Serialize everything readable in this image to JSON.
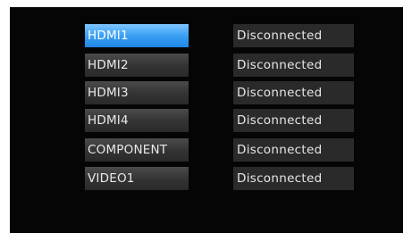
{
  "inputs": [
    {
      "label": "HDMI1",
      "status": "Disconnected",
      "selected": true
    },
    {
      "label": "HDMI2",
      "status": "Disconnected",
      "selected": false
    },
    {
      "label": "HDMI3",
      "status": "Disconnected",
      "selected": false
    },
    {
      "label": "HDMI4",
      "status": "Disconnected",
      "selected": false
    },
    {
      "label": "COMPONENT",
      "status": "Disconnected",
      "selected": false
    },
    {
      "label": "VIDEO1",
      "status": "Disconnected",
      "selected": false
    }
  ],
  "colors": {
    "screen_background": "#050505",
    "selected_highlight": "#3aa0f4",
    "item_background": "#333333",
    "status_background": "#2a2a2a"
  }
}
